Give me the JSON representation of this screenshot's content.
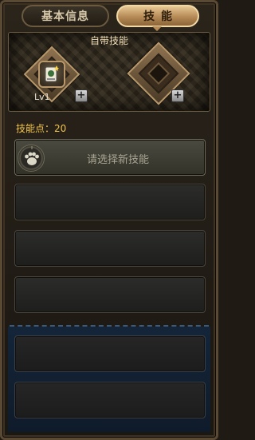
{
  "tabs": {
    "basic_info": "基本信息",
    "skills": "技能"
  },
  "innate": {
    "title": "自带技能",
    "skill_level": "Lv1",
    "add_symbol": "+"
  },
  "skill_points": {
    "label": "技能点：20"
  },
  "select_slot": {
    "text": "请选择新技能",
    "icon": "paw-icon"
  },
  "colors": {
    "points": "#f2c34b",
    "active_tab": "#d4ac74",
    "locked_area": "#14253a"
  }
}
